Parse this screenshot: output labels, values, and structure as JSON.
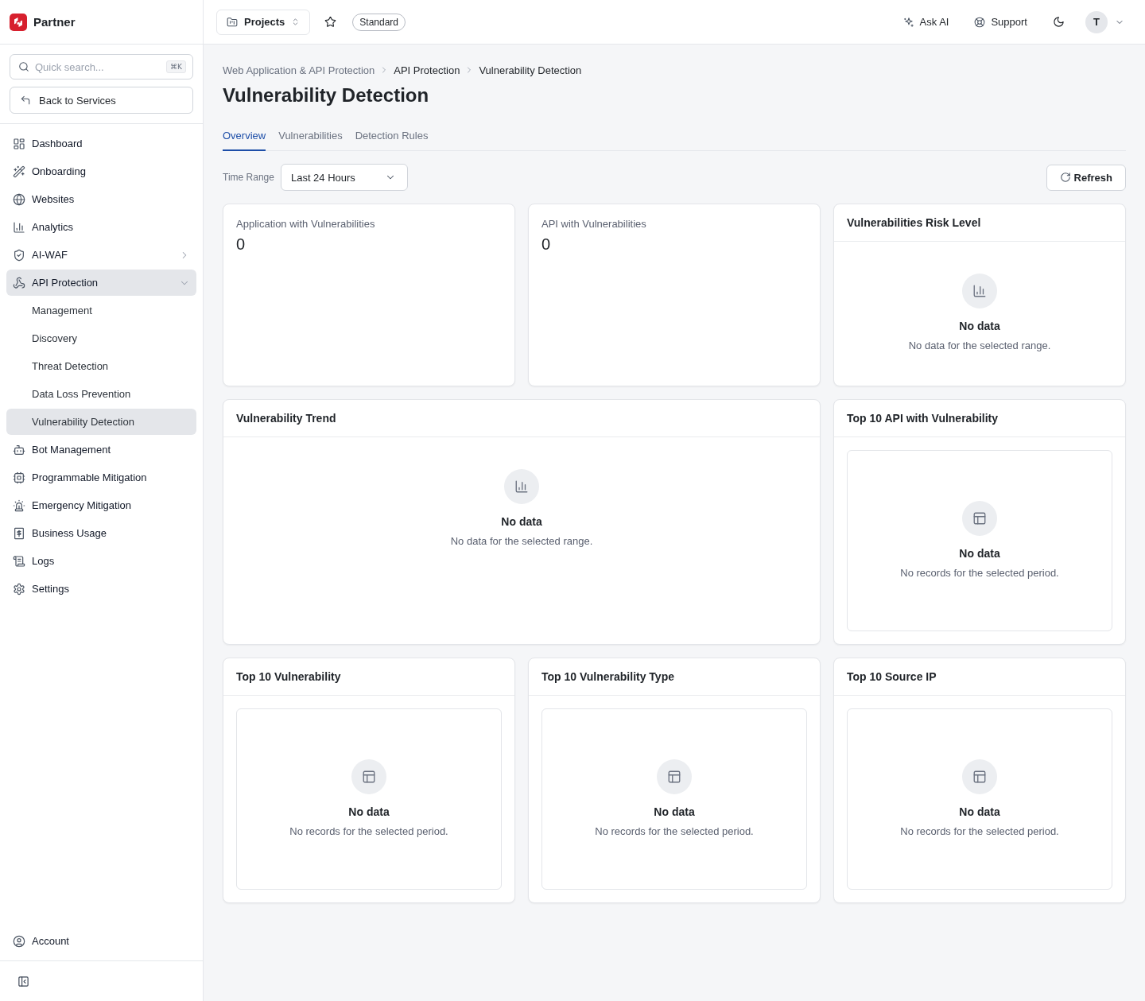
{
  "sidebar": {
    "brand": "Partner",
    "search": {
      "placeholder": "Quick search...",
      "shortcut": "⌘K"
    },
    "back_button": "Back to Services",
    "items": [
      {
        "kind": "link",
        "label": "Dashboard",
        "selected": false
      },
      {
        "kind": "link",
        "label": "Onboarding",
        "selected": false
      },
      {
        "kind": "link",
        "label": "Websites",
        "selected": false
      },
      {
        "kind": "link",
        "label": "Analytics",
        "selected": false
      },
      {
        "kind": "group",
        "label": "AI-WAF",
        "selected": false,
        "expanded": false
      },
      {
        "kind": "group",
        "label": "API Protection",
        "selected": true,
        "expanded": true,
        "children": [
          {
            "label": "Management",
            "selected": false
          },
          {
            "label": "Discovery",
            "selected": false
          },
          {
            "label": "Threat Detection",
            "selected": false
          },
          {
            "label": "Data Loss Prevention",
            "selected": false
          },
          {
            "label": "Vulnerability Detection",
            "selected": true
          }
        ]
      },
      {
        "kind": "link",
        "label": "Bot Management",
        "selected": false
      },
      {
        "kind": "link",
        "label": "Programmable Mitigation",
        "selected": false
      },
      {
        "kind": "link",
        "label": "Emergency Mitigation",
        "selected": false
      },
      {
        "kind": "link",
        "label": "Business Usage",
        "selected": false
      },
      {
        "kind": "link",
        "label": "Logs",
        "selected": false
      },
      {
        "kind": "link",
        "label": "Settings",
        "selected": false
      }
    ],
    "account": "Account"
  },
  "header": {
    "project_button": "Projects",
    "plan_badge": "Standard",
    "ask_ai": "Ask AI",
    "support": "Support",
    "avatar_initial": "T"
  },
  "page": {
    "breadcrumb": [
      "Web Application & API Protection",
      "API Protection",
      "Vulnerability Detection"
    ],
    "title": "Vulnerability Detection",
    "tabs": [
      {
        "label": "Overview",
        "selected": true
      },
      {
        "label": "Vulnerabilities",
        "selected": false
      },
      {
        "label": "Detection Rules",
        "selected": false
      }
    ],
    "time_range": {
      "label": "Time Range",
      "value": "Last 24 Hours"
    },
    "refresh_button": "Refresh",
    "rows": [
      {
        "cards": [
          {
            "kind": "stat",
            "label": "Application with Vulnerabilities",
            "value": "0"
          },
          {
            "kind": "stat",
            "label": "API with Vulnerabilities",
            "value": "0"
          },
          {
            "kind": "chart",
            "title": "Vulnerabilities Risk Level",
            "empty_title": "No data",
            "empty_text": "No data for the selected range."
          }
        ]
      },
      {
        "cards": [
          {
            "kind": "chart",
            "title": "Vulnerability Trend",
            "empty_title": "No data",
            "empty_text": "No data for the selected range."
          },
          {
            "kind": "table",
            "title": "Top 10 API with Vulnerability",
            "empty_title": "No data",
            "empty_text": "No records for the selected period."
          }
        ]
      },
      {
        "cards": [
          {
            "kind": "table",
            "title": "Top 10 Vulnerability",
            "empty_title": "No data",
            "empty_text": "No records for the selected period."
          },
          {
            "kind": "table",
            "title": "Top 10 Vulnerability Type",
            "empty_title": "No data",
            "empty_text": "No records for the selected period."
          },
          {
            "kind": "table",
            "title": "Top 10 Source IP",
            "empty_title": "No data",
            "empty_text": "No records for the selected period."
          }
        ]
      }
    ]
  }
}
